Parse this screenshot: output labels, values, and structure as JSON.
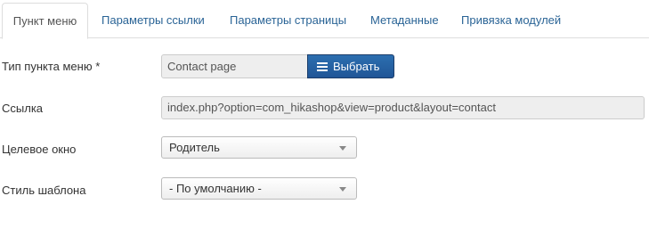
{
  "tabs": [
    {
      "label": "Пункт меню",
      "active": true
    },
    {
      "label": "Параметры ссылки",
      "active": false
    },
    {
      "label": "Параметры страницы",
      "active": false
    },
    {
      "label": "Метаданные",
      "active": false
    },
    {
      "label": "Привязка модулей",
      "active": false
    }
  ],
  "form": {
    "menu_item_type": {
      "label": "Тип пункта меню *",
      "value": "Contact page",
      "button_label": "Выбрать"
    },
    "link": {
      "label": "Ссылка",
      "value": "index.php?option=com_hikashop&view=product&layout=contact"
    },
    "target_window": {
      "label": "Целевое окно",
      "selected": "Родитель"
    },
    "template_style": {
      "label": "Стиль шаблона",
      "selected": "- По умолчанию -"
    }
  },
  "colors": {
    "link": "#2a6496",
    "button": "#205597",
    "border": "#dddddd"
  }
}
